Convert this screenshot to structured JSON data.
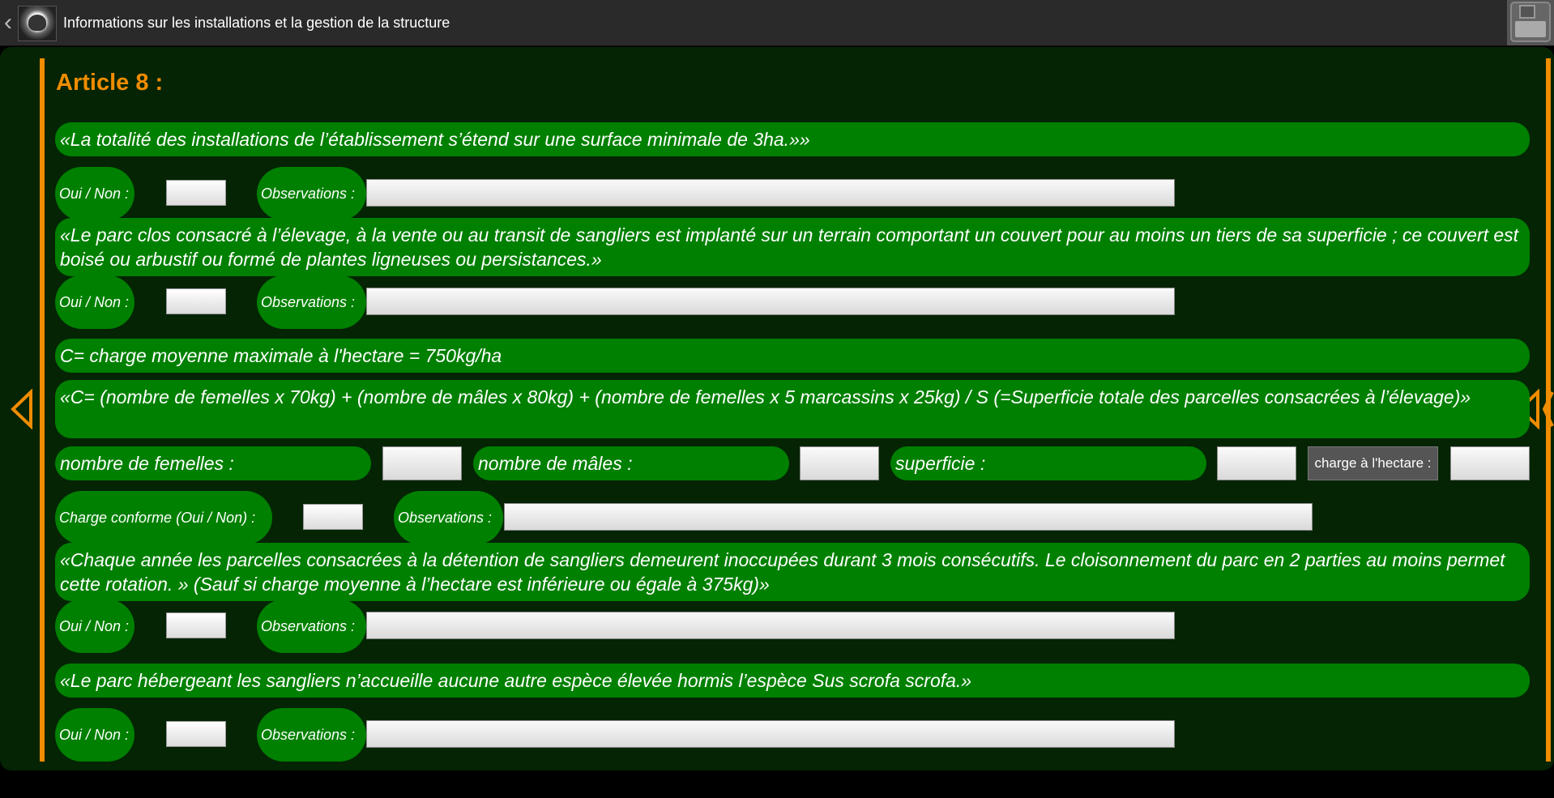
{
  "header": {
    "title": "Informations sur les installations et la gestion de la structure",
    "back_icon": "chevron-left-icon",
    "logo_icon": "boar-logo",
    "save_icon": "floppy-disk-icon"
  },
  "colors": {
    "accent": "#f08c00",
    "panel_background": "#042404",
    "statement_green": "#008000",
    "topbar": "#2a2a2a"
  },
  "article": {
    "title": "Article 8 :"
  },
  "questions": [
    {
      "text": "«La totalité des installations de l’établissement s’étend sur une surface minimale de 3ha.»»",
      "yes_no_label": "Oui / Non :",
      "yes_no_value": "",
      "observations_label": "Observations :",
      "observations_value": ""
    },
    {
      "text": "«Le parc clos consacré à l’élevage, à la vente ou au transit de sangliers est implanté sur un terrain comportant un couvert pour au moins un tiers de sa superficie ; ce couvert est boisé ou arbustif ou formé de plantes ligneuses ou persistances.»",
      "yes_no_label": "Oui / Non :",
      "yes_no_value": "",
      "observations_label": "Observations :",
      "observations_value": ""
    },
    {
      "text": "«Chaque année les parcelles consacrées à la détention de sangliers demeurent inoccupées durant 3 mois consécutifs. Le cloisonnement du parc en 2 parties au moins permet cette rotation. »  (Sauf si charge moyenne à l’hectare est inférieure ou égale à 375kg)»",
      "yes_no_label": "Oui / Non :",
      "yes_no_value": "",
      "observations_label": "Observations :",
      "observations_value": ""
    },
    {
      "text": "«Le parc hébergeant les sangliers n’accueille aucune autre espèce élevée hormis l’espèce Sus scrofa scrofa.»",
      "yes_no_label": "Oui / Non :",
      "yes_no_value": "",
      "observations_label": "Observations :",
      "observations_value": ""
    }
  ],
  "charge": {
    "definition": "C= charge moyenne maximale à l'hectare = 750kg/ha",
    "formula": "«C= (nombre de femelles x 70kg) + (nombre de mâles x 80kg) + (nombre de femelles x 5 marcassins x 25kg) / S (=Superficie totale des parcelles consacrées à l’élevage)»",
    "females_label": "nombre de femelles :",
    "females_value": "",
    "males_label": "nombre de mâles :",
    "males_value": "",
    "area_label": "superficie :",
    "area_value": "",
    "compute_button_label": "charge à l'hectare :",
    "compute_value": "",
    "conform_label": "Charge conforme (Oui / Non) :",
    "conform_value": "",
    "observations_label": "Observations :",
    "observations_value": ""
  },
  "navigation": {
    "previous_icon": "triangle-left-icon",
    "next_icon": "triangle-left-double-icon"
  }
}
